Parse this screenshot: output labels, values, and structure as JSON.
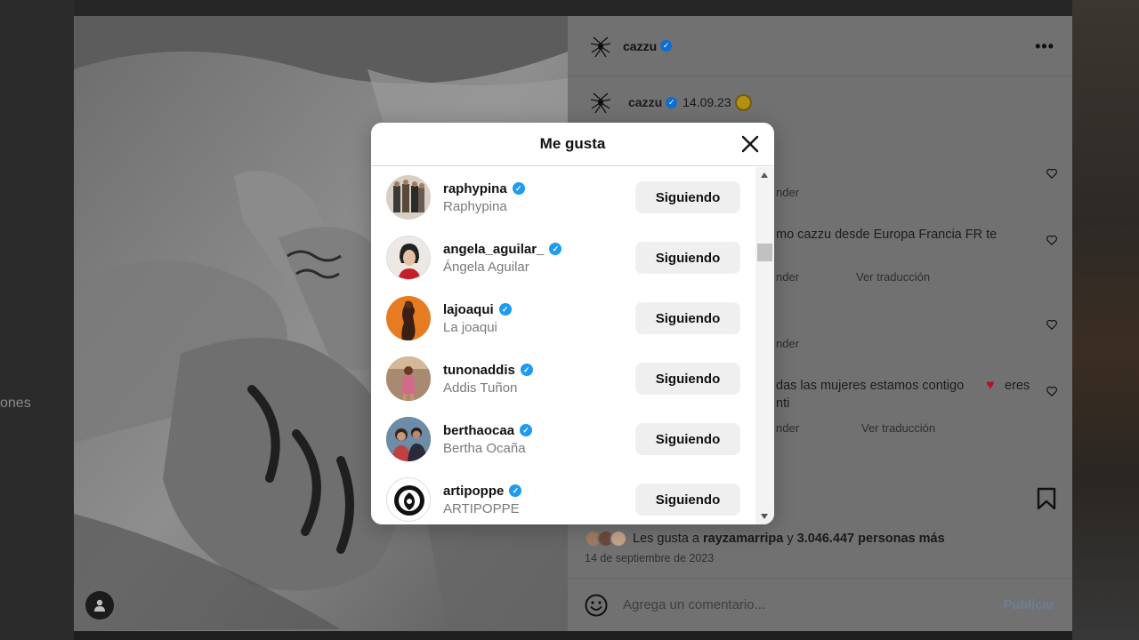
{
  "background": {
    "left_fragment_text": "ones"
  },
  "post": {
    "header": {
      "username": "cazzu",
      "verified": true
    },
    "caption": {
      "username": "cazzu",
      "date_text": "14.09.23",
      "emoji": "sun-emoji"
    },
    "comments": [
      {
        "text": "",
        "meta": "nder",
        "has_translate": false
      },
      {
        "text": "mo cazzu desde Europa Francia FR te",
        "meta": "nder",
        "translate": "Ver traducción",
        "has_translate": true
      },
      {
        "text": "",
        "meta": "nder",
        "has_translate": false
      },
      {
        "text": "das las mujeres estamos contigo",
        "text_end": "eres",
        "line2": "nti",
        "meta": "nder",
        "translate": "Ver traducción",
        "has_translate": true
      }
    ],
    "likes": {
      "prefix": "Les gusta a",
      "first_user": "rayzamarripa",
      "connector": "y",
      "others": "3.046.447 personas más"
    },
    "date": "14 de septiembre de 2023",
    "comment_box": {
      "placeholder": "Agrega un comentario...",
      "publish_label": "Publicar"
    }
  },
  "modal": {
    "title": "Me gusta",
    "users": [
      {
        "username": "raphypina",
        "full_name": "Raphypina",
        "verified": true,
        "button": "Siguiendo",
        "avatar_color": "#c9b9a3"
      },
      {
        "username": "angela_aguilar_",
        "full_name": "Ángela Aguilar",
        "verified": true,
        "button": "Siguiendo",
        "avatar_color": "#e9e4e0"
      },
      {
        "username": "lajoaqui",
        "full_name": "La joaqui",
        "verified": true,
        "button": "Siguiendo",
        "avatar_color": "#e77a26"
      },
      {
        "username": "tunonaddis",
        "full_name": "Addis Tuñon",
        "verified": true,
        "button": "Siguiendo",
        "avatar_color": "#c98a5c"
      },
      {
        "username": "berthaocaa",
        "full_name": "Bertha Ocaña",
        "verified": true,
        "button": "Siguiendo",
        "avatar_color": "#8a5a3c"
      },
      {
        "username": "artipoppe",
        "full_name": "ARTIPOPPE",
        "verified": true,
        "button": "Siguiendo",
        "avatar_color": "#ffffff"
      }
    ]
  },
  "colors": {
    "verified_blue": "#1d9bf0",
    "button_bg": "#efefef",
    "overlay_side": "#717171"
  }
}
